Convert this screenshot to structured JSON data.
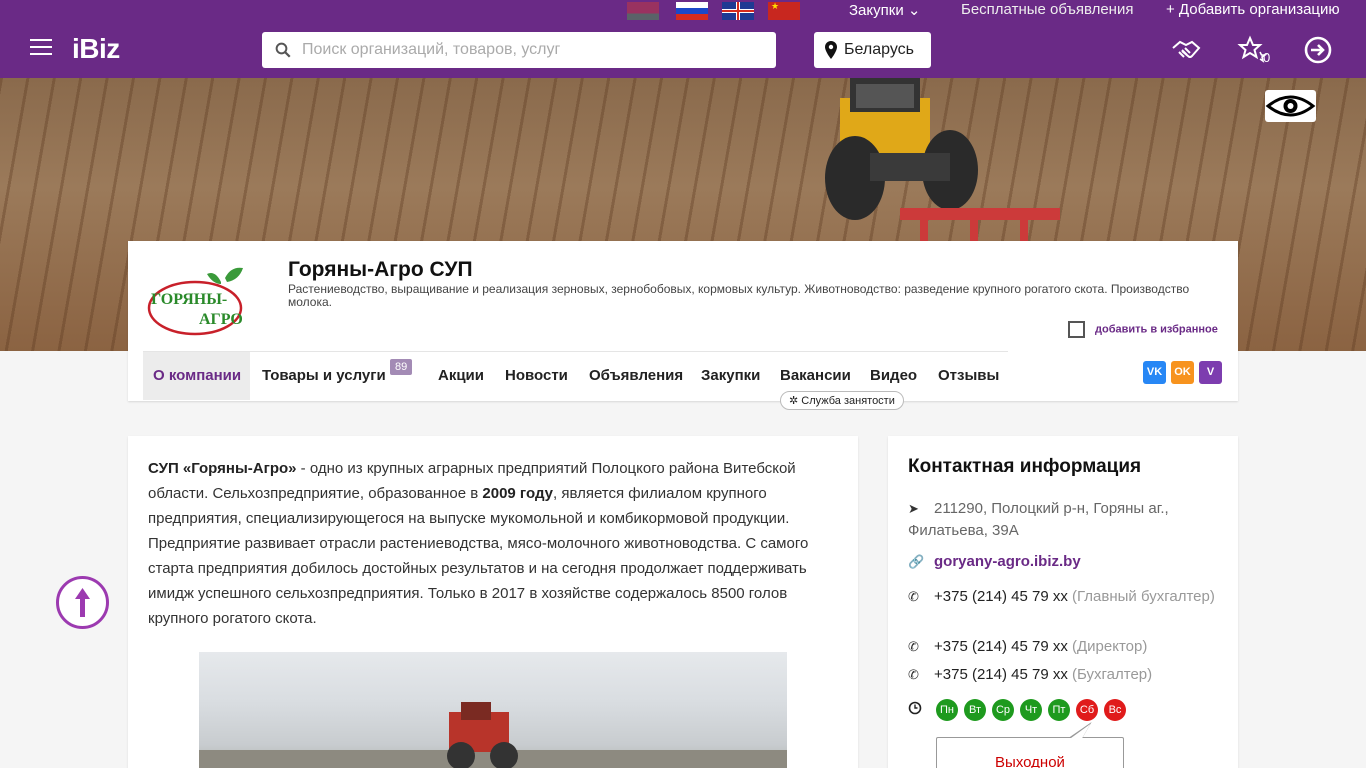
{
  "top_bar": {
    "flags": [
      "by",
      "ru",
      "uk",
      "cn"
    ],
    "zakupki": "Закупки ⌄",
    "free_ads": "Бесплатные объявления",
    "add_org": "+ Добавить организацию"
  },
  "header": {
    "logo": "iBiz",
    "search_placeholder": "Поиск организаций, товаров, услуг",
    "region": "Беларусь",
    "favorites_count": "0",
    "icons": [
      "menu-icon",
      "handshake-icon",
      "stars-icon",
      "login-icon",
      "search-icon",
      "map-pin-icon",
      "eye-icon"
    ]
  },
  "company": {
    "name": "Горяны-Агро СУП",
    "description": "Растениеводство, выращивание и реализация зерновых, зернобобовых, кормовых культур. Животноводство: разведение крупного рогатого скота. Производство молока.",
    "favorite_label": "добавить в избранное",
    "logo_text": [
      "ГОРЯНЫ-",
      "АГРО"
    ]
  },
  "tabs": [
    {
      "label": "О компании"
    },
    {
      "label": "Товары и услуги"
    },
    {
      "label": "Акции"
    },
    {
      "label": "Новости"
    },
    {
      "label": "Объявления"
    },
    {
      "label": "Закупки"
    },
    {
      "label": "Вакансии"
    },
    {
      "label": "Видео"
    },
    {
      "label": "Отзывы"
    }
  ],
  "tab_badge": "89",
  "sluzhba": "✲ Служба занятости",
  "social": {
    "vk": "VK",
    "ok": "OK",
    "viber": "V"
  },
  "about": {
    "p1_a": "СУП «Горяны-Агро»",
    "p1_b": " - одно из крупных аграрных предприятий Полоцкого района Витебской области. Сельхозпредприятие, образованное в ",
    "p1_c": "2009 году",
    "p1_d": ", является филиалом крупного предприятия, специализирующегося на выпуске мукомольной и комбикормовой продукции. Предприятие развивает отрасли растениеводства, мясо-молочного животноводства. С самого старта предприятия добилось достойных результатов и на сегодня продолжает поддерживать имидж успешного сельхозпредприятия. Только в 2017 в хозяйстве содержалось 8500 голов крупного рогатого скота."
  },
  "contacts": {
    "title": "Контактная информация",
    "address": "211290, Полоцкий р-н, Горяны аг., Филатьева, 39А",
    "site": "goryany-agro.ibiz.by",
    "phones": [
      {
        "number": "+375 (214) 45 79 xx",
        "note": "(Главный бухгалтер)"
      },
      {
        "number": "+375 (214) 45 79 xx",
        "note": "(Директор)"
      },
      {
        "number": "+375 (214) 45 79 xx",
        "note": "(Бухгалтер)"
      }
    ],
    "days": [
      {
        "label": "Пн",
        "status": "open"
      },
      {
        "label": "Вт",
        "status": "open"
      },
      {
        "label": "Ср",
        "status": "open"
      },
      {
        "label": "Чт",
        "status": "open"
      },
      {
        "label": "Пт",
        "status": "open"
      },
      {
        "label": "Сб",
        "status": "closed"
      },
      {
        "label": "Вс",
        "status": "closed"
      }
    ],
    "tooltip": "Выходной"
  },
  "colors": {
    "brand": "#6a2a86",
    "open": "#1e9a1e",
    "closed": "#e01b1b"
  }
}
